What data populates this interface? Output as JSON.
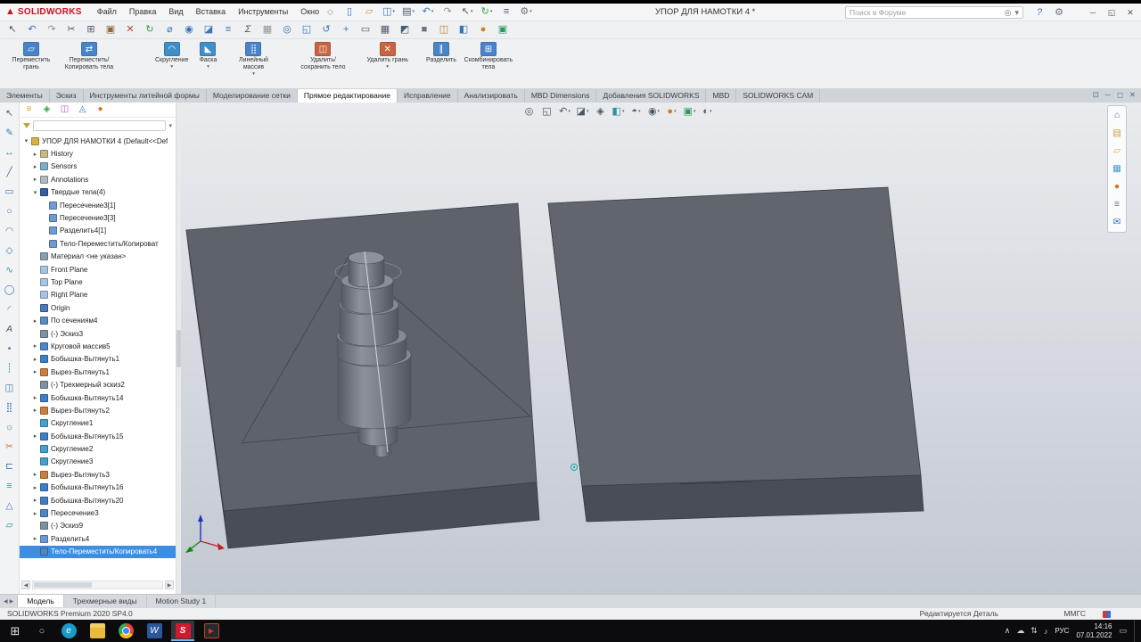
{
  "colors": {
    "accent": "#cf1020",
    "sel": "#3d8ee0",
    "vp-top": "#e9ebee",
    "vp-bottom": "#c3c9d2",
    "blk-top": "#5d626b",
    "blk-top2": "#61666e",
    "blk-front": "#494d55",
    "blk-side": "#40444b",
    "taskbar": "#0c0c0e"
  },
  "menubar": {
    "brand": "SOLIDWORKS",
    "menus": [
      "Файл",
      "Правка",
      "Вид",
      "Вставка",
      "Инструменты",
      "Окно"
    ],
    "pin_glyph": "◇",
    "quick_icons": [
      {
        "name": "new-file-icon",
        "glyph": "▯",
        "color": "#3a74b8"
      },
      {
        "name": "open-icon",
        "glyph": "▱",
        "color": "#c89a3a"
      },
      {
        "name": "save-icon",
        "glyph": "◫",
        "color": "#3a74b8",
        "arrow": true
      },
      {
        "name": "print-icon",
        "glyph": "▤",
        "color": "#4a5a6c",
        "arrow": true
      },
      {
        "name": "undo-icon",
        "glyph": "↶",
        "color": "#3a74b8",
        "arrow": true
      },
      {
        "name": "redo-icon",
        "glyph": "↷",
        "color": "#8a94a0"
      },
      {
        "name": "select-icon",
        "glyph": "↖",
        "color": "#4a5a6c",
        "arrow": true
      },
      {
        "name": "rebuild-icon",
        "glyph": "↻",
        "color": "#38a048",
        "arrow": true
      },
      {
        "name": "file-properties-icon",
        "glyph": "≡",
        "color": "#4a5a6c"
      },
      {
        "name": "options-icon",
        "glyph": "⚙",
        "color": "#6a7480",
        "arrow": true
      }
    ],
    "title": "УПОР  ДЛЯ НАМОТКИ 4 *",
    "search_placeholder": "Поиск в Форуме",
    "search_icon_glyph": "◎",
    "search_arrow_glyph": "▾",
    "right_icons": [
      {
        "name": "help-icon",
        "glyph": "?",
        "color": "#3a74b8"
      },
      {
        "name": "settings-icon",
        "glyph": "⚙",
        "color": "#6a7480"
      }
    ],
    "window_icons": [
      {
        "name": "minimize-window-icon",
        "glyph": "─"
      },
      {
        "name": "restore-window-icon",
        "glyph": "◱"
      },
      {
        "name": "close-window-icon",
        "glyph": "✕"
      }
    ]
  },
  "toolbar2": {
    "icons": [
      {
        "name": "select-tool-icon",
        "glyph": "↖",
        "color": "#4a5a6c"
      },
      {
        "name": "undo-tool-icon",
        "glyph": "↶",
        "color": "#3a74b8"
      },
      {
        "name": "redo-tool-icon",
        "glyph": "↷",
        "color": "#8a94a0"
      },
      {
        "name": "cut-tool-icon",
        "glyph": "✂",
        "color": "#4a5a6c"
      },
      {
        "name": "copy-tool-icon",
        "glyph": "⊞",
        "color": "#4a5a6c"
      },
      {
        "name": "paste-tool-icon",
        "glyph": "▣",
        "color": "#8a6a3a"
      },
      {
        "name": "delete-tool-icon",
        "glyph": "✕",
        "color": "#c04040"
      },
      {
        "name": "rebuild-tool-icon",
        "glyph": "↻",
        "color": "#38a048"
      },
      {
        "name": "measure-icon",
        "glyph": "⌀",
        "color": "#3a74b8"
      },
      {
        "name": "mass-properties-icon",
        "glyph": "◉",
        "color": "#3a74b8"
      },
      {
        "name": "section-properties-icon",
        "glyph": "◪",
        "color": "#3a74b8"
      },
      {
        "name": "statistics-icon",
        "glyph": "≡",
        "color": "#3a74b8"
      },
      {
        "name": "equations-icon",
        "glyph": "Σ",
        "color": "#4a5a6c"
      },
      {
        "name": "material-icon",
        "glyph": "▦",
        "color": "#8a94a0"
      },
      {
        "name": "zoom-fit-icon",
        "glyph": "◎",
        "color": "#3a74b8"
      },
      {
        "name": "zoom-area-icon",
        "glyph": "◱",
        "color": "#3a74b8"
      },
      {
        "name": "rotate-view-icon",
        "glyph": "↺",
        "color": "#3a74b8"
      },
      {
        "name": "pan-icon",
        "glyph": "+",
        "color": "#3a74b8"
      },
      {
        "name": "wireframe-icon",
        "glyph": "▭",
        "color": "#4a5a6c"
      },
      {
        "name": "hidden-lines-icon",
        "glyph": "▦",
        "color": "#4a5a6c"
      },
      {
        "name": "shaded-edges-icon",
        "glyph": "◩",
        "color": "#4a5a6c"
      },
      {
        "name": "shaded-icon",
        "glyph": "■",
        "color": "#6a7480"
      },
      {
        "name": "section-view-icon",
        "glyph": "◫",
        "color": "#c07a30"
      },
      {
        "name": "view-orientation-icon",
        "glyph": "◧",
        "color": "#3a74b8"
      },
      {
        "name": "appearance-icon",
        "glyph": "●",
        "color": "#d07a28"
      },
      {
        "name": "scene-icon",
        "glyph": "▣",
        "color": "#2f9a60"
      }
    ]
  },
  "ribbon": {
    "buttons": [
      {
        "label": "Переместить грань",
        "iconGlyph": "▱",
        "iconBg": "#4a84c8"
      },
      {
        "label": "Переместить/Копировать тела",
        "iconGlyph": "⇄",
        "iconBg": "#4a84c8"
      },
      {
        "label": "Скругление",
        "iconGlyph": "◠",
        "iconBg": "#3f8ec8",
        "arrow": true,
        "sep": "big"
      },
      {
        "label": "Фаска",
        "iconGlyph": "◣",
        "iconBg": "#3f8ec8",
        "arrow": true
      },
      {
        "label": "Линейный массив",
        "iconGlyph": "⣿",
        "iconBg": "#4a84c8",
        "arrow": true
      },
      {
        "label": "Удалить/сохранить тело",
        "iconGlyph": "◫",
        "iconBg": "#c8643f",
        "sep": "small"
      },
      {
        "label": "Удалить грань",
        "iconGlyph": "✕",
        "iconBg": "#c8643f",
        "arrow": true,
        "sep": "small"
      },
      {
        "label": "Разделить",
        "iconGlyph": "∥",
        "iconBg": "#4a84c8",
        "sep": "small"
      },
      {
        "label": "Скомбинировать тела",
        "iconGlyph": "⊞",
        "iconBg": "#4a84c8"
      }
    ]
  },
  "tabs": {
    "items": [
      {
        "label": "Элементы"
      },
      {
        "label": "Эскиз"
      },
      {
        "label": "Инструменты литейной формы"
      },
      {
        "label": "Моделирование сетки"
      },
      {
        "label": "Прямое редактирование",
        "active": true
      },
      {
        "label": "Исправление"
      },
      {
        "label": "Анализировать"
      },
      {
        "label": "MBD Dimensions"
      },
      {
        "label": "Добавления SOLIDWORKS"
      },
      {
        "label": "MBD"
      },
      {
        "label": "SOLIDWORKS CAM"
      }
    ],
    "window_icons": [
      {
        "name": "dock-pane-icon",
        "glyph": "⊡"
      },
      {
        "name": "minimize-doc-icon",
        "glyph": "─"
      },
      {
        "name": "restore-doc-icon",
        "glyph": "◻"
      },
      {
        "name": "close-doc-icon",
        "glyph": "✕"
      }
    ]
  },
  "left_toolbar": {
    "icons": [
      {
        "name": "select-arrow-icon",
        "glyph": "↖",
        "color": "#4a5a6c"
      },
      {
        "name": "sketch-icon",
        "glyph": "✎",
        "color": "#3f74b0"
      },
      {
        "name": "smart-dimension-icon",
        "glyph": "↔",
        "color": "#2f8ea0"
      },
      {
        "name": "line-icon",
        "glyph": "╱",
        "color": "#3f74b0"
      },
      {
        "name": "rectangle-icon",
        "glyph": "▭",
        "color": "#3f74b0"
      },
      {
        "name": "circle-icon",
        "glyph": "○",
        "color": "#3f74b0"
      },
      {
        "name": "arc-icon",
        "glyph": "◠",
        "color": "#3f74b0"
      },
      {
        "name": "polygon-icon",
        "glyph": "◇",
        "color": "#3f74b0"
      },
      {
        "name": "spline-icon",
        "glyph": "∿",
        "color": "#2f8ea0"
      },
      {
        "name": "ellipse-icon",
        "glyph": "◯",
        "color": "#3f74b0"
      },
      {
        "name": "sketch-fillet-icon",
        "glyph": "◜",
        "color": "#2f8ea0"
      },
      {
        "name": "text-icon",
        "glyph": "A",
        "color": "#4a5a6c"
      },
      {
        "name": "point-icon",
        "glyph": "•",
        "color": "#3f74b0"
      },
      {
        "name": "centerline-icon",
        "glyph": "┊",
        "color": "#2f8ea0"
      },
      {
        "name": "mirror-entities-icon",
        "glyph": "◫",
        "color": "#3f74b0"
      },
      {
        "name": "linear-sketch-pattern-icon",
        "glyph": "⣿",
        "color": "#3f74b0"
      },
      {
        "name": "circular-sketch-pattern-icon",
        "glyph": "☼",
        "color": "#2f8ea0"
      },
      {
        "name": "trim-entities-icon",
        "glyph": "✂",
        "color": "#c07a30"
      },
      {
        "name": "convert-entities-icon",
        "glyph": "⊏",
        "color": "#3f74b0"
      },
      {
        "name": "offset-entities-icon",
        "glyph": "≡",
        "color": "#2f8ea0"
      },
      {
        "name": "3d-sketch-icon",
        "glyph": "△",
        "color": "#3f74b0"
      },
      {
        "name": "reference-plane-icon",
        "glyph": "▱",
        "color": "#2f8ea0"
      }
    ]
  },
  "tree_panel": {
    "manager_tabs": [
      {
        "name": "featuremanager-tab-icon",
        "glyph": "≡",
        "color": "#c8a030"
      },
      {
        "name": "propertymanager-tab-icon",
        "glyph": "◈",
        "color": "#38a048"
      },
      {
        "name": "configurationmanager-tab-icon",
        "glyph": "◫",
        "color": "#b060b0"
      },
      {
        "name": "dimxpertmanager-tab-icon",
        "glyph": "◬",
        "color": "#3a74b8"
      },
      {
        "name": "displaymanager-tab-icon",
        "glyph": "●",
        "color": "#d07a28"
      }
    ],
    "filter_placeholder": "",
    "items": [
      {
        "label": "УПОР ДЛЯ НАМОТКИ 4 (Default<<Def",
        "level": 0,
        "icon": "part",
        "expand": "down"
      },
      {
        "label": "History",
        "level": 1,
        "icon": "history",
        "expand": "right"
      },
      {
        "label": "Sensors",
        "level": 1,
        "icon": "sensors",
        "expand": "right"
      },
      {
        "label": "Annotations",
        "level": 1,
        "icon": "annotations",
        "expand": "right"
      },
      {
        "label": "Твердые тела(4)",
        "level": 1,
        "icon": "solids",
        "expand": "down"
      },
      {
        "label": "Пересечение3[1]",
        "level": 2,
        "icon": "body"
      },
      {
        "label": "Пересечение3[3]",
        "level": 2,
        "icon": "body"
      },
      {
        "label": "Разделить4[1]",
        "level": 2,
        "icon": "body"
      },
      {
        "label": "Тело-Переместить/Копироват",
        "level": 2,
        "icon": "body"
      },
      {
        "label": "Материал <не указан>",
        "level": 1,
        "icon": "material"
      },
      {
        "label": "Front Plane",
        "level": 1,
        "icon": "plane"
      },
      {
        "label": "Top Plane",
        "level": 1,
        "icon": "plane"
      },
      {
        "label": "Right Plane",
        "level": 1,
        "icon": "plane"
      },
      {
        "label": "Origin",
        "level": 1,
        "icon": "origin"
      },
      {
        "label": "По сечениям4",
        "level": 1,
        "icon": "loft",
        "expand": "right"
      },
      {
        "label": "(-) Эскиз3",
        "level": 1,
        "icon": "sketch"
      },
      {
        "label": "Круговой массив5",
        "level": 1,
        "icon": "cirpattern",
        "expand": "right"
      },
      {
        "label": "Бобышка-Вытянуть1",
        "level": 1,
        "icon": "boss",
        "expand": "right"
      },
      {
        "label": "Вырез-Вытянуть1",
        "level": 1,
        "icon": "cut",
        "expand": "right"
      },
      {
        "label": "(-) Трехмерный эскиз2",
        "level": 1,
        "icon": "sketch3d"
      },
      {
        "label": "Бобышка-Вытянуть14",
        "level": 1,
        "icon": "boss",
        "expand": "right"
      },
      {
        "label": "Вырез-Вытянуть2",
        "level": 1,
        "icon": "cut",
        "expand": "right"
      },
      {
        "label": "Скругление1",
        "level": 1,
        "icon": "fillet"
      },
      {
        "label": "Бобышка-Вытянуть15",
        "level": 1,
        "icon": "boss",
        "expand": "right"
      },
      {
        "label": "Скругление2",
        "level": 1,
        "icon": "fillet"
      },
      {
        "label": "Скругление3",
        "level": 1,
        "icon": "fillet"
      },
      {
        "label": "Вырез-Вытянуть3",
        "level": 1,
        "icon": "cut",
        "expand": "right"
      },
      {
        "label": "Бобышка-Вытянуть16",
        "level": 1,
        "icon": "boss",
        "expand": "right"
      },
      {
        "label": "Бобышка-Вытянуть20",
        "level": 1,
        "icon": "boss",
        "expand": "right"
      },
      {
        "label": "Пересечение3",
        "level": 1,
        "icon": "intersect",
        "expand": "right"
      },
      {
        "label": "(-) Эскиз9",
        "level": 1,
        "icon": "sketch"
      },
      {
        "label": "Разделить4",
        "level": 1,
        "icon": "split",
        "expand": "right"
      },
      {
        "label": "Тело-Переместить/Копировать4",
        "level": 1,
        "icon": "movebody",
        "selected": true
      }
    ]
  },
  "headsup": {
    "icons": [
      {
        "name": "zoom-fit-hud-icon",
        "glyph": "◎",
        "color": "#4a5664"
      },
      {
        "name": "zoom-area-hud-icon",
        "glyph": "◱",
        "color": "#4a5664"
      },
      {
        "name": "previous-view-icon",
        "glyph": "↶",
        "color": "#4a5664",
        "arrow": true
      },
      {
        "name": "section-view-hud-icon",
        "glyph": "◪",
        "color": "#4a5664",
        "arrow": true
      },
      {
        "name": "dynamic-annotation-icon",
        "glyph": "◈",
        "color": "#4a5664"
      },
      {
        "name": "view-orientation-hud-icon",
        "glyph": "◧",
        "color": "#2f8ea0",
        "arrow": true
      },
      {
        "name": "display-style-icon",
        "glyph": "◓",
        "color": "#4a5664",
        "arrow": true
      },
      {
        "name": "hide-show-items-icon",
        "glyph": "◉",
        "color": "#4a5664",
        "arrow": true
      },
      {
        "name": "edit-appearance-icon",
        "glyph": "●",
        "color": "#d07a28",
        "arrow": true
      },
      {
        "name": "apply-scene-icon",
        "glyph": "▣",
        "color": "#2f9a60",
        "arrow": true
      },
      {
        "name": "view-settings-icon",
        "glyph": "◐",
        "color": "#4a5664",
        "arrow": true
      }
    ]
  },
  "taskpane": {
    "icons": [
      {
        "name": "solidworks-resources-icon",
        "glyph": "⌂",
        "color": "#3a74b8"
      },
      {
        "name": "design-library-icon",
        "glyph": "▤",
        "color": "#c89a3a"
      },
      {
        "name": "file-explorer-icon",
        "glyph": "▱",
        "color": "#c8b03a"
      },
      {
        "name": "view-palette-icon",
        "glyph": "▦",
        "color": "#3a9ac0"
      },
      {
        "name": "appearances-scenes-icon",
        "glyph": "●",
        "color": "#d07a28"
      },
      {
        "name": "custom-properties-icon",
        "glyph": "≡",
        "color": "#6a7480"
      },
      {
        "name": "forum-icon",
        "glyph": "✉",
        "color": "#3a74b8"
      }
    ]
  },
  "bottom_tabs": {
    "nav_icons": [
      {
        "name": "sheet-scroll-left-icon",
        "glyph": "◀"
      },
      {
        "name": "sheet-scroll-right-icon",
        "glyph": "▶"
      }
    ],
    "items": [
      {
        "label": "Модель",
        "active": true
      },
      {
        "label": "Трехмерные виды"
      },
      {
        "label": "Motion Study 1"
      }
    ]
  },
  "statusbar": {
    "product": "SOLIDWORKS Premium 2020 SP4.0",
    "state": "Редактируется Деталь",
    "units": "ММГС"
  },
  "taskbar": {
    "start_glyph": "⊞",
    "search_glyph": "○",
    "apps": [
      {
        "name": "edge-browser-icon",
        "kind": "edge",
        "glyph": "e"
      },
      {
        "name": "file-explorer-taskbar-icon",
        "kind": "folder",
        "glyph": ""
      },
      {
        "name": "chrome-icon",
        "kind": "chrome",
        "glyph": ""
      },
      {
        "name": "word-icon",
        "kind": "word",
        "glyph": "W"
      },
      {
        "name": "solidworks-taskbar-icon",
        "kind": "solidworks",
        "glyph": "S",
        "active": true
      },
      {
        "name": "media-player-icon",
        "kind": "player",
        "glyph": "▶"
      }
    ],
    "tray": [
      {
        "name": "tray-expand-icon",
        "glyph": "∧"
      },
      {
        "name": "onedrive-icon",
        "glyph": "☁"
      },
      {
        "name": "network-icon",
        "glyph": "⇅"
      },
      {
        "name": "volume-icon",
        "glyph": "♪"
      }
    ],
    "lang": "РУС",
    "time": "14:16",
    "date": "07.01.2022",
    "notification_glyph": "▭"
  }
}
